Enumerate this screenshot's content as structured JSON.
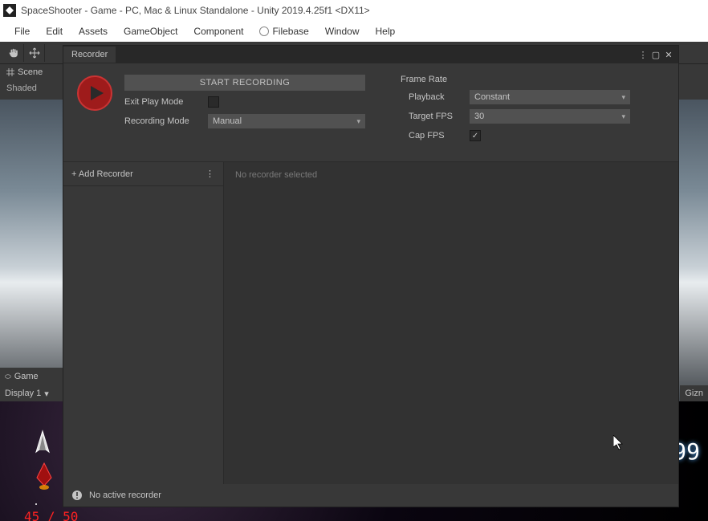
{
  "titlebar": {
    "text": "SpaceShooter - Game - PC, Mac & Linux Standalone - Unity 2019.4.25f1 <DX11>"
  },
  "menubar": {
    "file": "File",
    "edit": "Edit",
    "assets": "Assets",
    "gameObject": "GameObject",
    "component": "Component",
    "filebase": "Filebase",
    "window": "Window",
    "help": "Help"
  },
  "sceneTab": {
    "label": "Scene",
    "mode": "Shaded"
  },
  "gameTab": {
    "label": "Game",
    "display": "Display 1"
  },
  "gizmos": {
    "label": "Gizn"
  },
  "gameView": {
    "score": "99",
    "hp": "45 / 50"
  },
  "recorder": {
    "tabLabel": "Recorder",
    "startButton": "START RECORDING",
    "exitPlayMode": {
      "label": "Exit Play Mode",
      "checked": false
    },
    "recordingMode": {
      "label": "Recording Mode",
      "value": "Manual"
    },
    "frameRateSection": "Frame Rate",
    "playback": {
      "label": "Playback",
      "value": "Constant"
    },
    "targetFps": {
      "label": "Target FPS",
      "value": "30"
    },
    "capFps": {
      "label": "Cap FPS",
      "checked": true
    },
    "addRecorder": "+ Add Recorder",
    "moreMenu": "⋮",
    "emptyDetail": "No recorder selected",
    "status": "No active recorder"
  }
}
